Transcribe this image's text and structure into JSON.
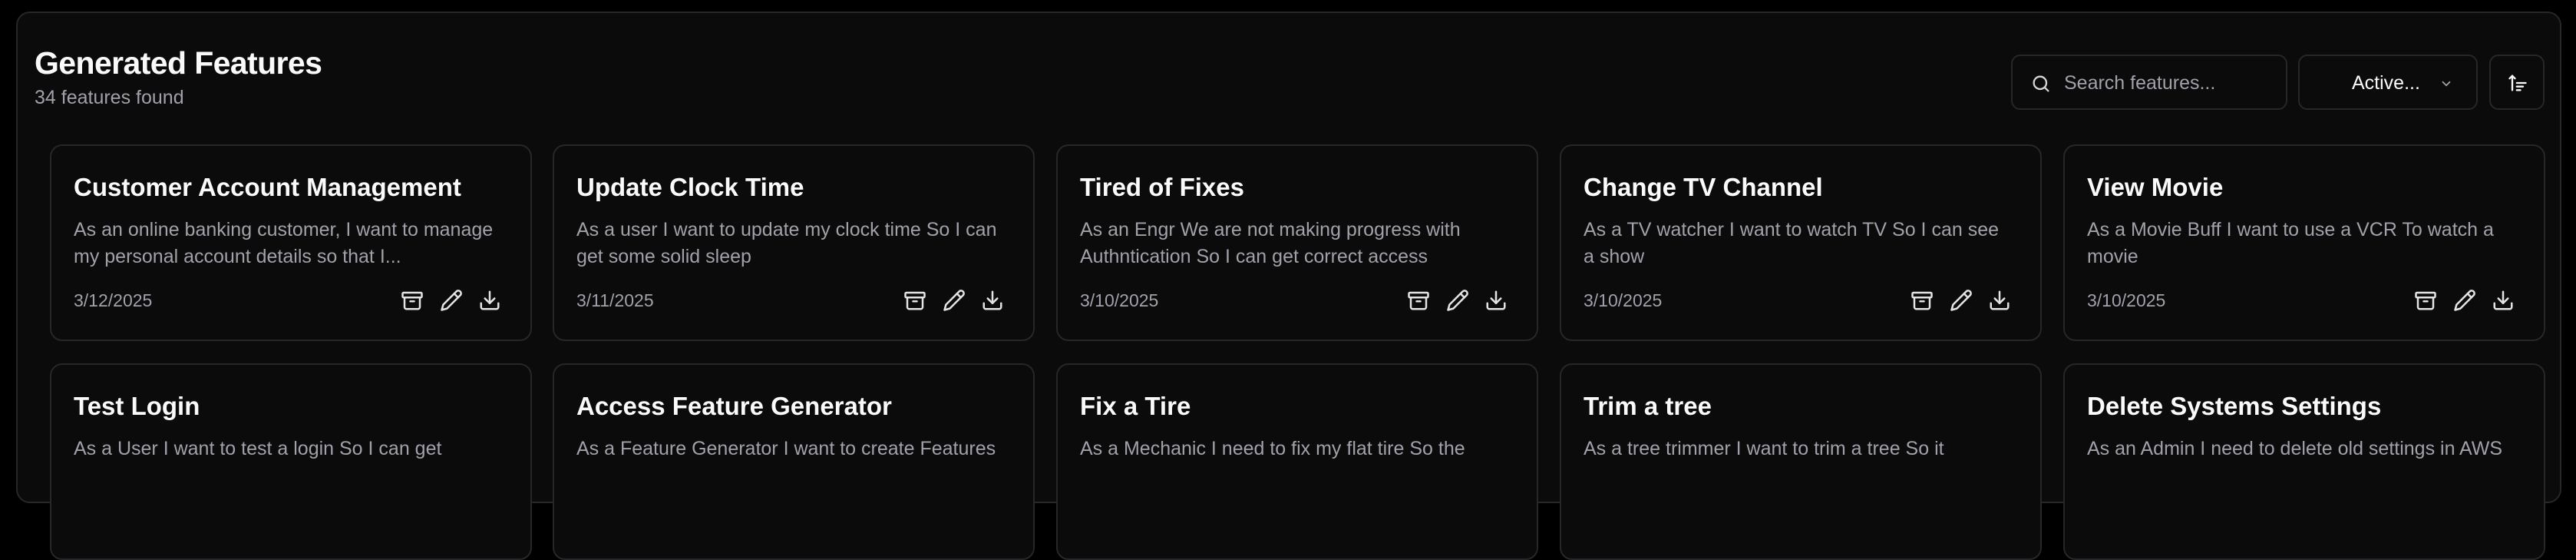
{
  "header": {
    "title": "Generated Features",
    "count_text": "34 features found"
  },
  "toolbar": {
    "search_placeholder": "Search features...",
    "filter_value": "Active..."
  },
  "features": [
    {
      "title": "Customer Account Management",
      "description": "As an online banking customer, I want to manage my personal account details so that I...",
      "date": "3/12/2025"
    },
    {
      "title": "Update Clock Time",
      "description": "As a user I want to update my clock time So I can get some solid sleep",
      "date": "3/11/2025"
    },
    {
      "title": "Tired of Fixes",
      "description": "As an Engr We are not making progress with Authntication So I can get correct access",
      "date": "3/10/2025"
    },
    {
      "title": "Change TV Channel",
      "description": "As a TV watcher I want to watch TV So I can see a show",
      "date": "3/10/2025"
    },
    {
      "title": "View Movie",
      "description": "As a Movie Buff I want to use a VCR To watch a movie",
      "date": "3/10/2025"
    },
    {
      "title": "Test Login",
      "description": "As a User I want to test a login So I can get",
      "date": ""
    },
    {
      "title": "Access Feature Generator",
      "description": "As a Feature Generator I want to create Features",
      "date": ""
    },
    {
      "title": "Fix a Tire",
      "description": "As a Mechanic I need to fix my flat tire So the",
      "date": ""
    },
    {
      "title": "Trim a tree",
      "description": "As a tree trimmer I want to trim a tree So it",
      "date": ""
    },
    {
      "title": "Delete Systems Settings",
      "description": "As an Admin I need to delete old settings in AWS",
      "date": ""
    }
  ],
  "icons": {
    "search": "search-icon",
    "filter_chevron": "chevron-down-icon",
    "sort": "sort-ascending-icon",
    "archive": "archive-icon",
    "edit": "pencil-icon",
    "download": "download-icon"
  },
  "colors": {
    "background": "#000000",
    "panel": "#0b0b0b",
    "border": "#27272a",
    "text_primary": "#fafafa",
    "text_muted": "#a1a1aa"
  }
}
